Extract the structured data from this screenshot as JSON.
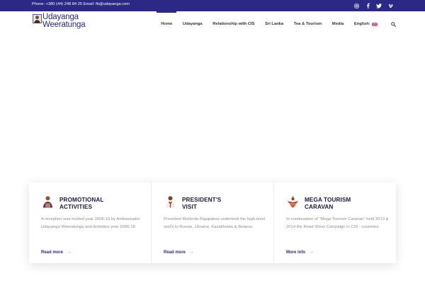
{
  "topbar": {
    "contact": "Phone: +380 (44) 248 84 25 Email: fb@udayanga.com",
    "social": [
      "instagram-icon",
      "facebook-icon",
      "twitter-icon",
      "vimeo-icon"
    ]
  },
  "logo": {
    "line1": "Udayanga",
    "line2": "Weeratunga"
  },
  "nav": {
    "items": [
      "Home",
      "Udayanga",
      "Relationship with CIS",
      "Sri Lanka",
      "Tea & Tourism",
      "Media",
      "English:"
    ],
    "active": "Home"
  },
  "cards": [
    {
      "title": "PROMOTIONAL\nACTIVITIES",
      "desc": "A reception was hosted year 2006-15 by Ambassador Udayanga Weeratunga and Activities year 2006-18",
      "link": "Read more"
    },
    {
      "title": "PRESIDENT'S\nVISIT",
      "desc": "President Mahinda Rajapaksa undertook the high-level visit's to Russia, Ukraine, Kazakhstan & Belarus.",
      "link": "Read more"
    },
    {
      "title": "MEGA TOURISM\nCARAVAN",
      "desc": "In continuation of \"Mega Tourism Caravan\" held 2013 & 2014 the Road Show Campaign in CIS - countries.",
      "link": "More info"
    }
  ],
  "colors": {
    "brand": "#2b2886",
    "accent": "#27a9c6"
  }
}
